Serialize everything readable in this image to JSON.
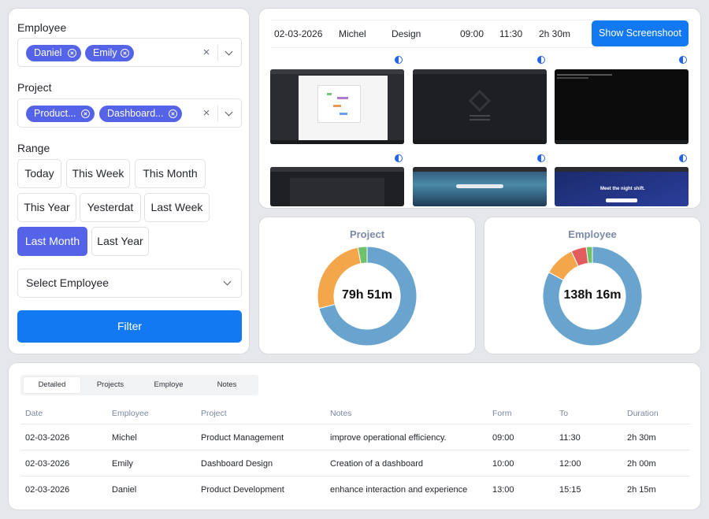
{
  "filters": {
    "employee_label": "Employee",
    "employee_chips": [
      "Daniel",
      "Emily"
    ],
    "project_label": "Project",
    "project_chips": [
      "Product...",
      "Dashboard..."
    ],
    "clear_symbol": "×",
    "range_label": "Range",
    "ranges": [
      "Today",
      "This Week",
      "This Month",
      "This Year",
      "Yesterdat",
      "Last Week",
      "Last Month",
      "Last Year"
    ],
    "active_range": "Last Month",
    "select_employee": "Select Employee",
    "filter_button": "Filter"
  },
  "screenshots": {
    "row": {
      "date": "02-03-2026",
      "employee": "Michel",
      "project": "Design",
      "from": "09:00",
      "to": "11:30",
      "duration": "2h 30m"
    },
    "show_button": "Show Screenshoot",
    "thumb6_text": "Meet the night shift."
  },
  "charts": {
    "project": {
      "title": "Project",
      "total": "79h 51m"
    },
    "employee": {
      "title": "Employee",
      "total": "138h 16m"
    }
  },
  "chart_data": [
    {
      "type": "pie",
      "title": "Project",
      "center_label": "79h 51m",
      "values": [
        71,
        26,
        3
      ],
      "colors": [
        "#69a4cf",
        "#f4a64b",
        "#6fc16b"
      ]
    },
    {
      "type": "pie",
      "title": "Employee",
      "center_label": "138h 16m",
      "values": [
        83,
        10,
        5,
        2
      ],
      "colors": [
        "#69a4cf",
        "#f4a64b",
        "#e15d5d",
        "#6fc16b"
      ]
    }
  ],
  "table": {
    "tabs": [
      "Detailed",
      "Projects",
      "Employe",
      "Notes"
    ],
    "active_tab": "Detailed",
    "columns": [
      "Date",
      "Employee",
      "Project",
      "Notes",
      "Form",
      "To",
      "Duration"
    ],
    "rows": [
      [
        "02-03-2026",
        "Michel",
        "Product Management",
        "improve operational efficiency.",
        "09:00",
        "11:30",
        "2h 30m"
      ],
      [
        "02-03-2026",
        "Emily",
        "Dashboard Design",
        "Creation of a dashboard",
        "10:00",
        "12:00",
        "2h 00m"
      ],
      [
        "02-03-2026",
        "Daniel",
        "Product Development",
        "enhance interaction and experience",
        "13:00",
        "15:15",
        "2h 15m"
      ]
    ]
  },
  "colors": {
    "accent": "#5463e8",
    "primary": "#1279f2",
    "header_text": "#7a88a2"
  }
}
